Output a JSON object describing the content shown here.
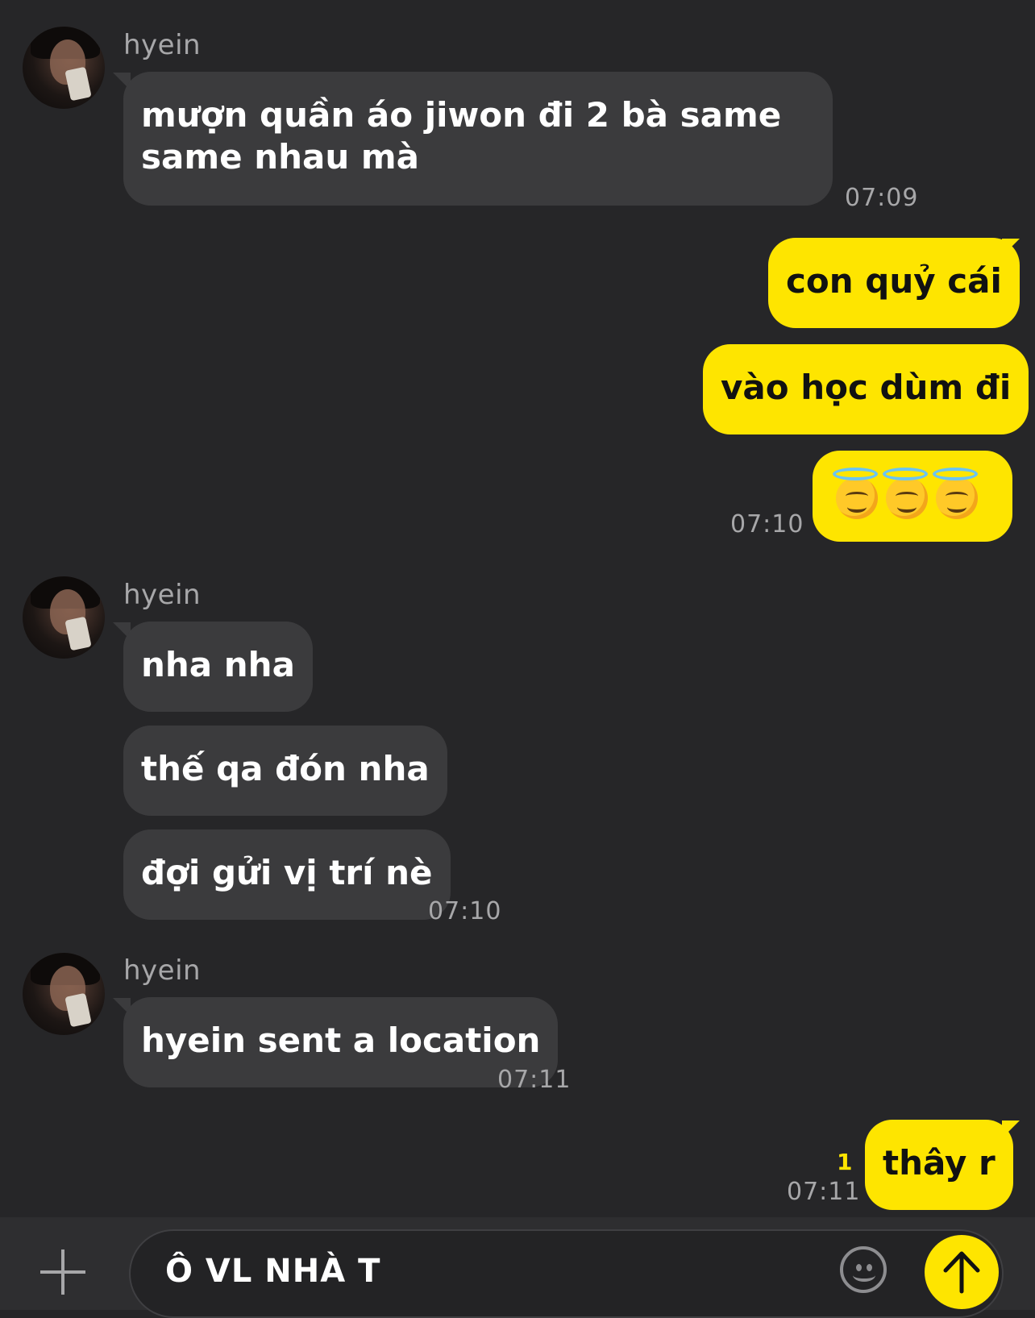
{
  "contact_name": "hyein",
  "messages": {
    "m1_text": "mượn quần áo jiwon đi 2 bà same same nhau mà",
    "m1_time": "07:09",
    "m2_text": "con quỷ cái",
    "m3_text": "vào học dùm đi",
    "m4_emoji": [
      "smiling-face-with-halo",
      "smiling-face-with-halo",
      "smiling-face-with-halo"
    ],
    "m4_time": "07:10",
    "m5_text": "nha nha",
    "m6_text": "thế qa đón nha",
    "m7_text": "đợi gửi vị trí nè",
    "m7_time": "07:10",
    "m8_text": "hyein sent a location",
    "m8_time": "07:11",
    "m9_text": "thây r",
    "m9_unread": "1",
    "m9_time": "07:11"
  },
  "input": {
    "value": "Ô VL NHÀ T"
  },
  "colors": {
    "background": "#262628",
    "incoming_bubble": "#3b3b3d",
    "outgoing_bubble": "#fee500"
  }
}
